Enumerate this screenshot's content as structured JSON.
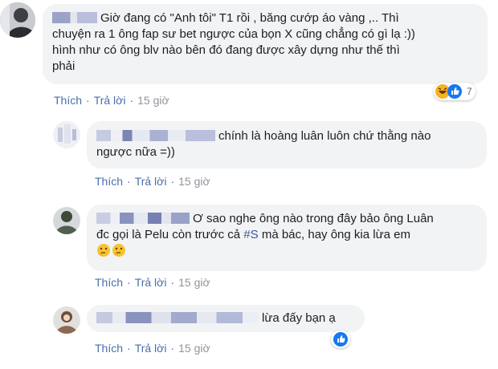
{
  "comments": [
    {
      "text_lines": [
        "Giờ đang có \"Anh tôi\" T1 rồi , băng cướp áo vàng ,.. Thì",
        "chuyện ra 1 ông fap sư bet ngược của bọn X cũng chẳng có gì lạ :))",
        "hình như có ông blv nào bên đó đang được xây dựng như thế thì",
        "phải"
      ],
      "like_label": "Thích",
      "reply_label": "Trả lời",
      "time": "15 giờ",
      "reaction_count": "7",
      "reactions": [
        "haha-icon",
        "like-icon"
      ]
    },
    {
      "text_lines": [
        "chính là hoàng luân luôn chứ thằng nào",
        "ngược nữa =))"
      ],
      "like_label": "Thích",
      "reply_label": "Trả lời",
      "time": "15 giờ"
    },
    {
      "text_lines": [
        "Ơ sao nghe ông nào trong đây bảo ông Luân",
        "đc gọi là Pelu còn trước cả ",
        " mà bác, hay ông kia lừa em"
      ],
      "hashtag": "#S",
      "like_label": "Thích",
      "reply_label": "Trả lời",
      "time": "15 giờ",
      "emojis": [
        "thinking-face-icon",
        "thinking-face-icon"
      ]
    },
    {
      "text_lines": [
        "lừa đấy bạn ạ"
      ],
      "like_label": "Thích",
      "reply_label": "Trả lời",
      "time": "15 giờ",
      "reactions": [
        "like-icon"
      ]
    }
  ],
  "colors": {
    "bubble": "#f2f3f5",
    "link": "#4b6ea8",
    "time": "#90949c",
    "like_blue": "#1877f2",
    "haha_yellow": "#f7b125"
  }
}
